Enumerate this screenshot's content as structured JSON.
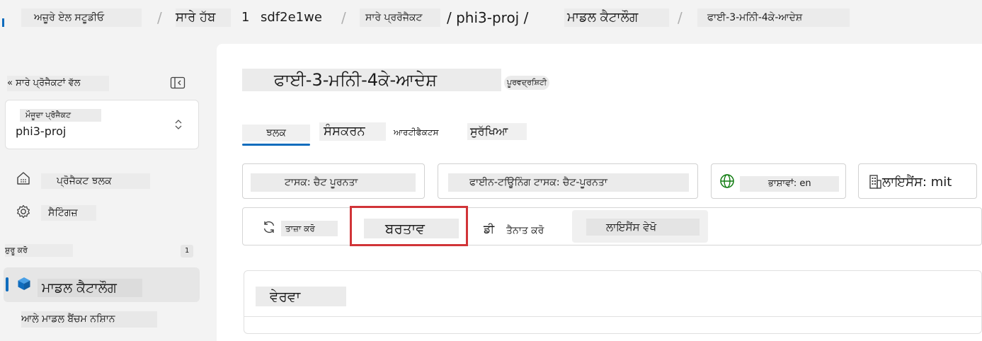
{
  "breadcrumb": {
    "items": [
      "ਅਜ਼ੂਰੇ ਏਲ ਸਟੂਡੀਓ",
      "ਸਾਰੇ ਹੱਬ",
      "1",
      "sdf2e1we",
      "ਸਾਰੇ ਪ੍ਰਰੋਜੈਕਟ",
      "/ phi3-proj /",
      "ਮਾਡਲ ਕੈਟਾਲੌਗ",
      "ਫਾਈ-3-ਮਨਿੀ-4ਕੇ-ਆਦੇਸ਼"
    ],
    "separator": "/"
  },
  "sidebar": {
    "back_link": "« ਸਾਰੇ ਪ੍ਰੋਜੈਕਟਾਂ ਵੱਲ",
    "current_project_label": "ਮੌਜੂਦਾ ਪ੍ਰੋਜੈਕਟ",
    "current_project_value": "phi3-proj",
    "project_overview": "ਪ੍ਰੋਜੈਕਟ ਝਲਕ",
    "settings": "ਸੈਟਿੰਗਜ਼",
    "section_label": "ਸ਼ੁਰੂ ਕਰੋ",
    "section_count": "1",
    "model_catalog": "ਮਾਡਲ ਕੈਟਾਲੌਗ",
    "model_benchmarks": "ਆਲੇ ਮਾਡਲ ਬੈਂਚਮ ਨਸ਼ਿਾਨ"
  },
  "main": {
    "title": "ਫਾਈ-3-ਮਨਿੀ-4ਕੇ-ਆਦੇਸ਼",
    "preview_badge": "ਪੂਰਵਦ੍ਰਸ਼ਿਟੀ",
    "tabs": [
      {
        "label": "ਝਲਕ",
        "active": true
      },
      {
        "label": "ਸੰਸਕਰਨ",
        "active": false
      },
      {
        "label": "ਆਰਟੀਫੈਕਟਸ",
        "active": false
      },
      {
        "label": "ਸੁਰੱਖਿਆ",
        "active": false
      }
    ],
    "chips": {
      "task": "ਟਾਸਕ: ਚੈਟ ਪੂਰਨਤਾ",
      "finetune": "ਫਾਈਨ-ਟਊਿਨਿੰਗ ਟਾਸਕ: ਚੈਟ-ਪੂਰਨਤਾ",
      "languages": "ਭਾਸ਼ਾਵਾਂ: en",
      "license": "ਲਾਇਸੈਂਸ: mit"
    },
    "actions": {
      "refresh": "ਤਾਜ਼ਾ ਕਰੋ",
      "use": "ਬਰਤਾਵ",
      "deploy_prefix": "ਡੀ",
      "deploy": "ਤੈਨਾਤ ਕਰੋ",
      "view_license": "ਲਾਇਸੈਂਸ ਵੇਖੋ"
    },
    "details_title": "ਵੇਰਵਾ"
  },
  "colors": {
    "accent": "#0f6cbd",
    "highlight_box": "#d13438",
    "language_icon": "#107c10"
  },
  "icons": {
    "collapse": "sidebar-collapse-icon",
    "chevron": "updown-chevron-icon",
    "home": "home-icon",
    "gear": "gear-icon",
    "cube": "cube-icon",
    "globe": "globe-icon",
    "building": "building-icon",
    "refresh": "refresh-icon"
  }
}
